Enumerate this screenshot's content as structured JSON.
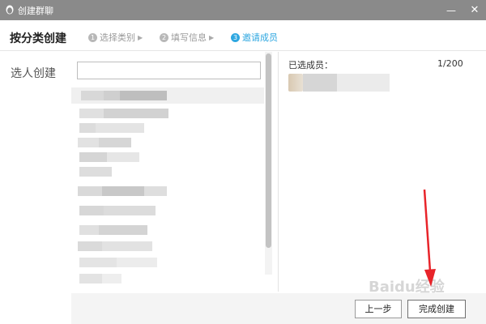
{
  "window": {
    "title": "创建群聊",
    "min_glyph": "—",
    "close_glyph": "✕"
  },
  "header": {
    "title": "按分类创建",
    "steps": [
      {
        "num": "1",
        "label": "选择类别",
        "arrow": "▶"
      },
      {
        "num": "2",
        "label": "填写信息",
        "arrow": "▶"
      },
      {
        "num": "3",
        "label": "邀请成员"
      }
    ]
  },
  "side_label": "选人创建",
  "search": {
    "value": "",
    "placeholder": ""
  },
  "selected": {
    "title": "已选成员：",
    "count": "1/200"
  },
  "buttons": {
    "prev": "上一步",
    "done": "完成创建"
  },
  "watermark": "Baidu经验",
  "colors": {
    "titlebar": "#8a8a8a",
    "accent": "#2ea7e0",
    "annotation": "#e8242a"
  },
  "icons": {
    "app": "penguin-icon",
    "minimize": "minimize-icon",
    "close": "close-icon"
  }
}
